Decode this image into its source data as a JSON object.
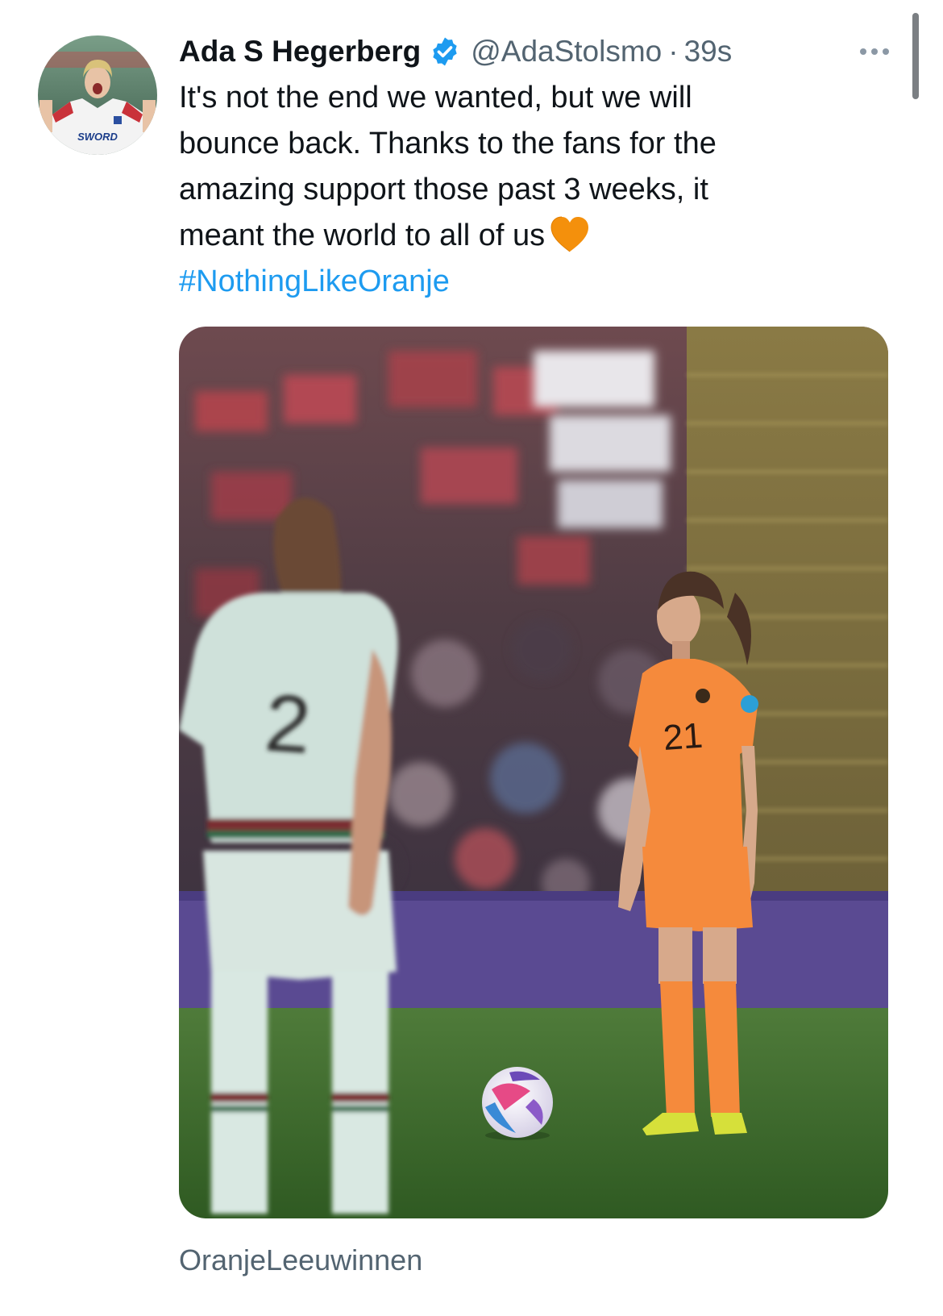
{
  "tweet": {
    "author_name": "Ada S Hegerberg",
    "handle": "@AdaStolsmo",
    "separator": "·",
    "time": "39s",
    "text_lines": [
      "It's not the end we wanted, but we will",
      "bounce back. Thanks to the fans for the",
      "amazing support those past 3 weeks, it",
      "meant the world to all of us"
    ],
    "hashtag": "#NothingLikeOranje",
    "emoji": "orange-heart"
  },
  "avatar": {
    "jersey_text": "SWORD"
  },
  "media": {
    "description_icon": "photo",
    "left_player_number": "2",
    "right_player_number": "21"
  },
  "photo_credit": "OranjeLeeuwinnen",
  "colors": {
    "link": "#1d9bf0",
    "verified": "#1d9bf0",
    "secondary_text": "#536471",
    "heart": "#f4900c",
    "oranje": "#f58a3c"
  }
}
